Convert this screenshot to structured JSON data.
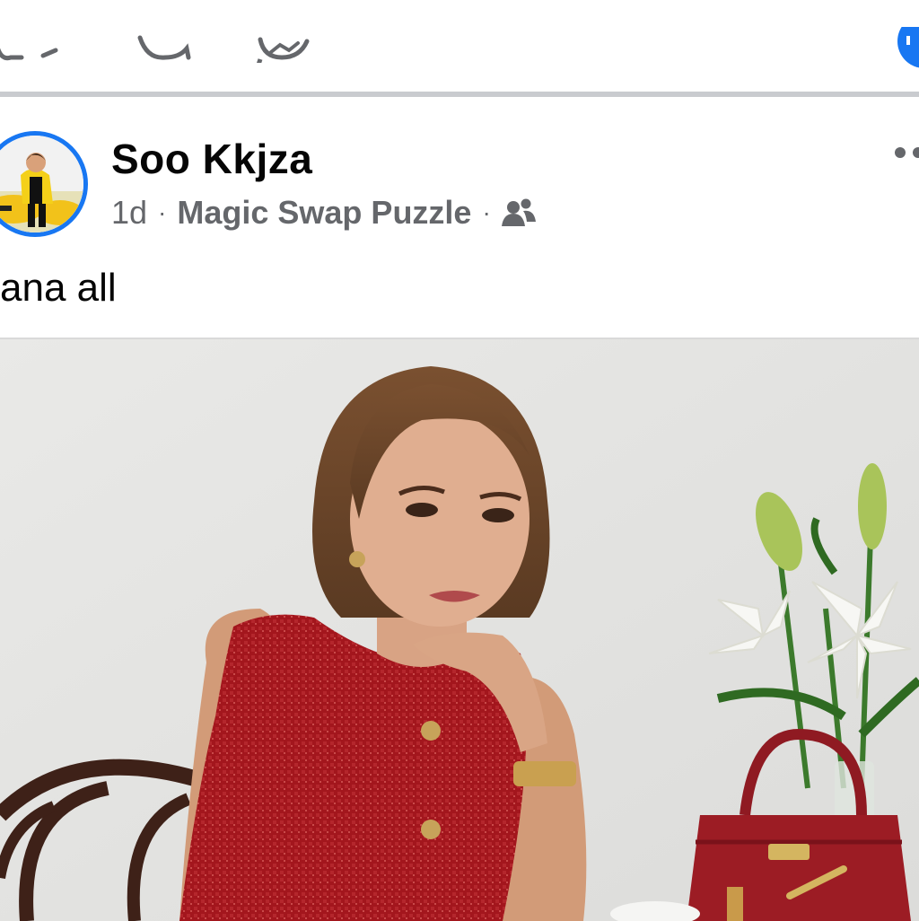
{
  "app": "Facebook",
  "colors": {
    "accent": "#1877f2",
    "meta_text": "#65676b",
    "divider": "#c9cbcf"
  },
  "top_actions": [
    {
      "name": "like-icon",
      "interactable": true
    },
    {
      "name": "comment-icon",
      "interactable": true
    },
    {
      "name": "messenger-icon",
      "interactable": true
    }
  ],
  "post": {
    "author": "Soo Kkjza",
    "time": "1d",
    "separator": "·",
    "group": "Magic Swap Puzzle",
    "audience_icon": "friends-icon",
    "more_icon": "more-options-icon",
    "caption": "ana all",
    "image": "photo of a woman in a red sleeveless tweed dress seated at a table beside white lilies and a red handbag"
  }
}
